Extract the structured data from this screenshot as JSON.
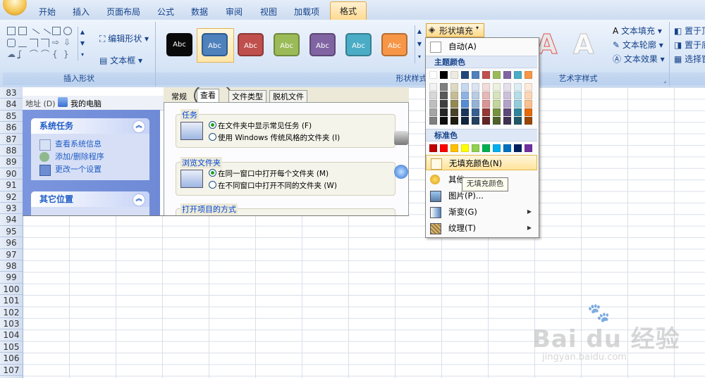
{
  "ribbon": {
    "tabs": [
      "开始",
      "插入",
      "页面布局",
      "公式",
      "数据",
      "审阅",
      "视图",
      "加载项",
      "格式"
    ],
    "active_tab": "格式",
    "groups": {
      "insert_shapes": "插入形状",
      "shape_styles": "形状样式",
      "art_styles": "艺术字样式"
    },
    "edit_shape": "编辑形状",
    "text_box": "文本框",
    "style_label": "Abc",
    "shape_fill": "形状填充",
    "text_fill": "文本填充",
    "text_outline": "文本轮廓",
    "text_effects": "文本效果",
    "bring_front": "置于顶",
    "send_back": "置于底",
    "selection": "选择窗",
    "style_colors": [
      "#0a0a0a",
      "#4f81bd",
      "#c0504d",
      "#9bbb59",
      "#8064a2",
      "#4bacc6",
      "#f79646"
    ]
  },
  "grid": {
    "rows": [
      "83",
      "84",
      "85",
      "86",
      "87",
      "88",
      "89",
      "90",
      "91",
      "92",
      "93",
      "94",
      "95",
      "96",
      "97",
      "98",
      "99",
      "100",
      "101",
      "102",
      "103",
      "104",
      "105",
      "106",
      "107"
    ]
  },
  "explorer": {
    "address_label": "地址 (D)",
    "address_value": "我的电脑",
    "tasks_title": "系统任务",
    "tasks": [
      "查看系统信息",
      "添加/删除程序",
      "更改一个设置"
    ],
    "other_title": "其它位置",
    "dialog_tabs": [
      "常规",
      "查看",
      "文件类型",
      "脱机文件"
    ],
    "group_tasks": "任务",
    "task_opt1": "在文件夹中显示常见任务 (F)",
    "task_opt2": "使用 Windows 传统风格的文件夹 (I)",
    "group_browse": "浏览文件夹",
    "browse_opt1": "在同一窗口中打开每个文件夹 (M)",
    "browse_opt2": "在不同窗口中打开不同的文件夹 (W)",
    "group_open": "打开项目的方式"
  },
  "dropdown": {
    "auto": "自动(A)",
    "theme_colors": "主题颜色",
    "standard_colors": "标准色",
    "no_fill": "无填充颜色(N)",
    "more": "其他",
    "picture": "图片(P)...",
    "gradient": "渐变(G)",
    "texture": "纹理(T)",
    "tooltip": "无填充颜色",
    "theme_top": [
      "#ffffff",
      "#000000",
      "#eeece1",
      "#1f497d",
      "#4f81bd",
      "#c0504d",
      "#9bbb59",
      "#8064a2",
      "#4bacc6",
      "#f79646"
    ],
    "theme_shades": [
      [
        "#f2f2f2",
        "#7f7f7f",
        "#ddd9c3",
        "#c6d9f0",
        "#dbe5f1",
        "#f2dcdb",
        "#ebf1dd",
        "#e5e0ec",
        "#dbeef3",
        "#fdeada"
      ],
      [
        "#d8d8d8",
        "#595959",
        "#c4bd97",
        "#8db3e2",
        "#b8cce4",
        "#e5b9b7",
        "#d7e3bc",
        "#ccc1d9",
        "#b7dde8",
        "#fbd5b5"
      ],
      [
        "#bfbfbf",
        "#3f3f3f",
        "#938953",
        "#548dd4",
        "#95b3d7",
        "#d99694",
        "#c3d69b",
        "#b2a2c7",
        "#92cddc",
        "#fac08f"
      ],
      [
        "#a5a5a5",
        "#262626",
        "#494429",
        "#17365d",
        "#366092",
        "#953734",
        "#76923c",
        "#5f497a",
        "#31859b",
        "#e36c09"
      ],
      [
        "#7f7f7f",
        "#0c0c0c",
        "#1d1b10",
        "#0f243e",
        "#244061",
        "#632423",
        "#4f6128",
        "#3f3151",
        "#205867",
        "#974806"
      ]
    ],
    "standard": [
      "#c00000",
      "#ff0000",
      "#ffc000",
      "#ffff00",
      "#92d050",
      "#00b050",
      "#00b0f0",
      "#0070c0",
      "#002060",
      "#7030a0"
    ]
  },
  "watermark": {
    "brand": "Bai du 经验",
    "url": "jingyan.baidu.com"
  }
}
